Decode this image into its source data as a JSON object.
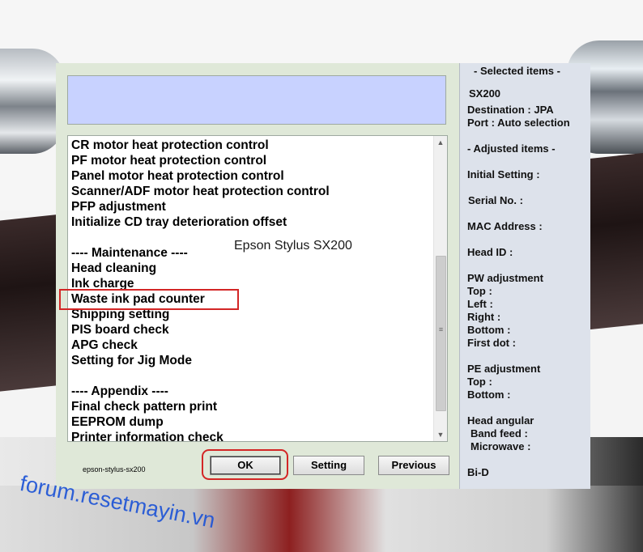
{
  "dialog": {
    "description_text": "",
    "overlay_title": "Epson Stylus SX200",
    "model_label": "epson-stylus-sx200",
    "list_items": [
      "CR motor heat protection control",
      "PF motor heat protection control",
      "Panel motor heat protection control",
      "Scanner/ADF motor heat protection control",
      "PFP adjustment",
      "Initialize CD tray deterioration offset",
      "",
      "---- Maintenance ----",
      "Head cleaning",
      "Ink charge",
      "Waste ink pad counter",
      "Shipping setting",
      "PIS board check",
      "APG check",
      "Setting for Jig Mode",
      "",
      "---- Appendix ----",
      "Final check pattern print",
      "EEPROM dump",
      "Printer information check"
    ],
    "highlighted_item": "Waste ink pad counter",
    "buttons": {
      "ok": "OK",
      "setting": "Setting",
      "previous": "Previous"
    },
    "scroll": {
      "up_arrow": "▲",
      "down_arrow": "▼",
      "grip": "≡"
    }
  },
  "right_panel": {
    "selected_header": "- Selected items -",
    "model": "SX200",
    "destination": "Destination : JPA",
    "port": "Port : Auto selection",
    "adjusted_header": "- Adjusted items -",
    "initial_setting": "Initial Setting :",
    "serial_no": "Serial No. :",
    "mac_address": "MAC Address :",
    "head_id": "Head ID :",
    "pw_adjustment": "PW adjustment",
    "pw_top": "Top :",
    "pw_left": "Left :",
    "pw_right": "Right :",
    "pw_bottom": "Bottom :",
    "pw_first_dot": "First dot :",
    "pe_adjustment": "PE adjustment",
    "pe_top": "Top :",
    "pe_bottom": "Bottom :",
    "head_angular": "Head angular",
    "band_feed": "Band feed :",
    "microwave": "Microwave :",
    "bi_d": "Bi-D"
  },
  "watermark": "forum.resetmayin.vn",
  "colors": {
    "dialog_bg": "#dfe8d8",
    "description_bg": "#c8d2ff",
    "right_panel_bg": "#dde2eb",
    "highlight_red": "#d32626",
    "watermark_blue": "#1e54d6"
  }
}
